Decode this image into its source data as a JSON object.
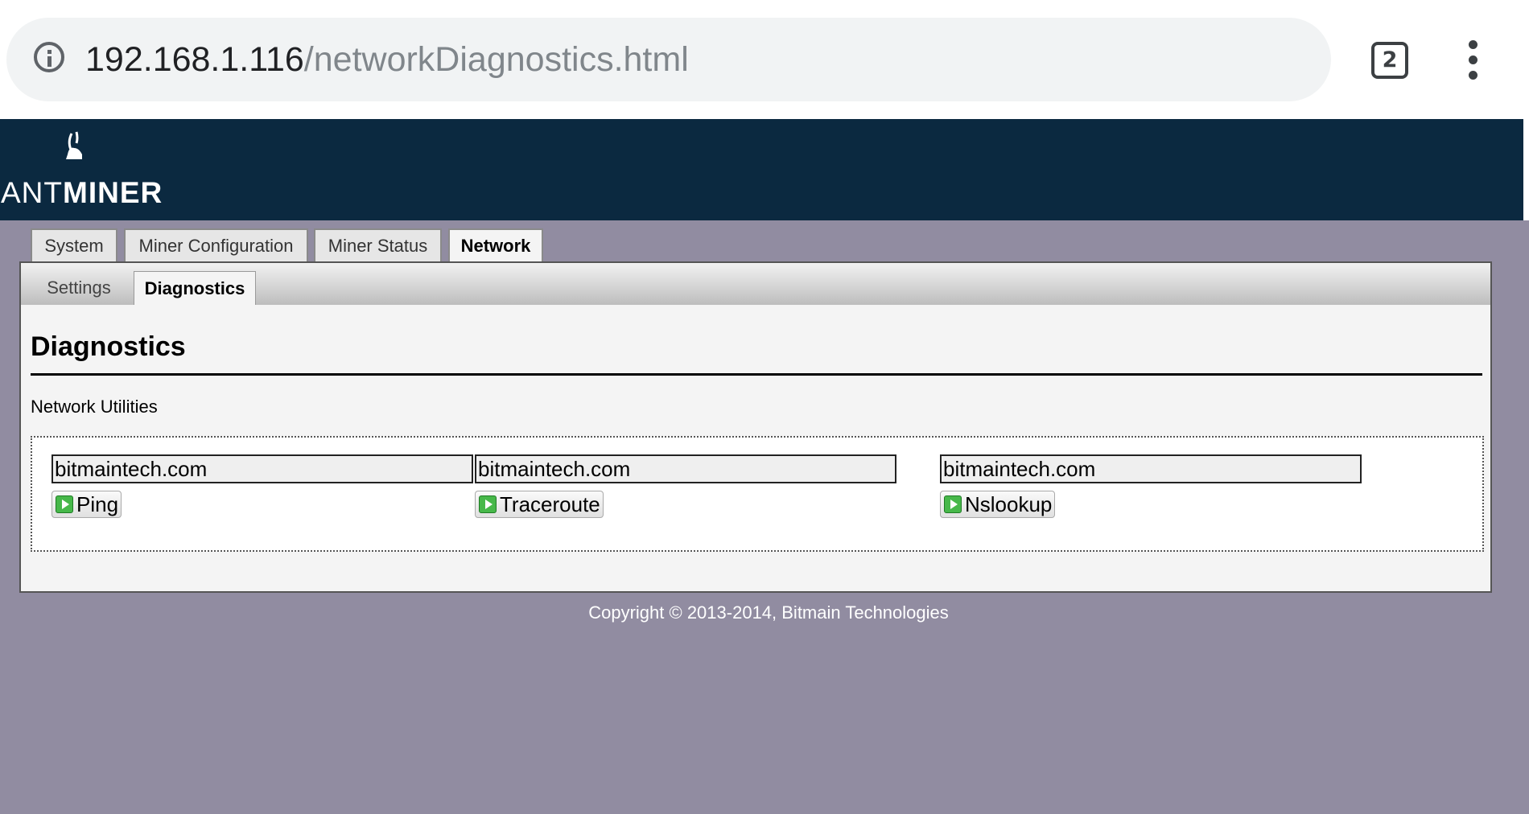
{
  "browser": {
    "url_host": "192.168.1.116",
    "url_path": "/networkDiagnostics.html",
    "tab_count": "2",
    "icons": [
      "info-icon",
      "tab-switcher-icon",
      "more-vert-icon"
    ]
  },
  "header": {
    "logo_text_light": "ANT",
    "logo_text_bold": "MINER",
    "background_color": "#0b2940"
  },
  "nav": {
    "tabs": [
      {
        "label": "System",
        "active": false
      },
      {
        "label": "Miner Configuration",
        "active": false
      },
      {
        "label": "Miner Status",
        "active": false
      },
      {
        "label": "Network",
        "active": true
      }
    ]
  },
  "subnav": {
    "tabs": [
      {
        "label": "Settings",
        "active": false
      },
      {
        "label": "Diagnostics",
        "active": true
      }
    ]
  },
  "main": {
    "title": "Diagnostics",
    "section_label": "Network Utilities",
    "tools": [
      {
        "host_value": "bitmaintech.com",
        "button_label": "Ping"
      },
      {
        "host_value": "bitmaintech.com",
        "button_label": "Traceroute"
      },
      {
        "host_value": "bitmaintech.com",
        "button_label": "Nslookup"
      }
    ]
  },
  "footer": {
    "copyright": "Copyright © 2013-2014, Bitmain Technologies"
  },
  "colors": {
    "page_background": "#918ca1",
    "button_icon_green": "#47b84a"
  }
}
